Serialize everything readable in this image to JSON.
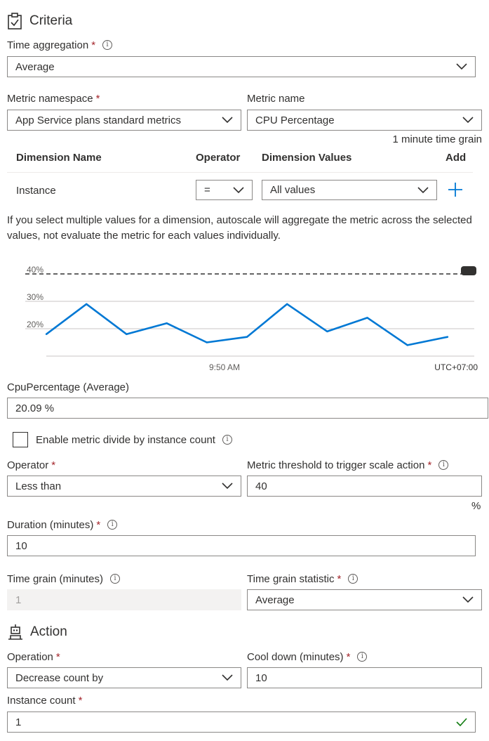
{
  "criteria": {
    "title": "Criteria",
    "time_aggregation": {
      "label": "Time aggregation",
      "value": "Average"
    },
    "metric_namespace": {
      "label": "Metric namespace",
      "value": "App Service plans standard metrics"
    },
    "metric_name": {
      "label": "Metric name",
      "value": "CPU Percentage",
      "time_grain_note": "1 minute time grain"
    },
    "dimension_table": {
      "headers": {
        "name": "Dimension Name",
        "operator": "Operator",
        "values": "Dimension Values",
        "add": "Add"
      },
      "rows": [
        {
          "name": "Instance",
          "operator": "=",
          "values": "All values"
        }
      ]
    },
    "info_text": "If you select multiple values for a dimension, autoscale will aggregate the metric across the selected values, not evaluate the metric for each values individually."
  },
  "chart_data": {
    "type": "line",
    "y_ticks": [
      "40%",
      "30%",
      "20%"
    ],
    "x_tick": "9:50 AM",
    "timezone": "UTC+07:00",
    "threshold": 40,
    "ylim": [
      10,
      40
    ],
    "values": [
      18,
      29,
      18,
      22,
      15,
      17,
      29,
      19,
      24,
      14,
      17
    ],
    "line_color": "#0078d4",
    "threshold_color": "#323130"
  },
  "metric_value": {
    "label": "CpuPercentage (Average)",
    "value": "20.09 %"
  },
  "divide_checkbox": {
    "label": "Enable metric divide by instance count",
    "checked": false
  },
  "operator": {
    "label": "Operator",
    "value": "Less than"
  },
  "threshold": {
    "label": "Metric threshold to trigger scale action",
    "value": "40",
    "unit": "%"
  },
  "duration": {
    "label": "Duration (minutes)",
    "value": "10"
  },
  "time_grain": {
    "label": "Time grain (minutes)",
    "value": "1"
  },
  "time_grain_statistic": {
    "label": "Time grain statistic",
    "value": "Average"
  },
  "action": {
    "title": "Action",
    "operation": {
      "label": "Operation",
      "value": "Decrease count by"
    },
    "cool_down": {
      "label": "Cool down (minutes)",
      "value": "10"
    },
    "instance_count": {
      "label": "Instance count",
      "value": "1"
    }
  },
  "required_mark": "*",
  "info_glyph": "i",
  "colors": {
    "accent": "#0078d4",
    "required": "#a4262c",
    "valid": "#107c10"
  }
}
